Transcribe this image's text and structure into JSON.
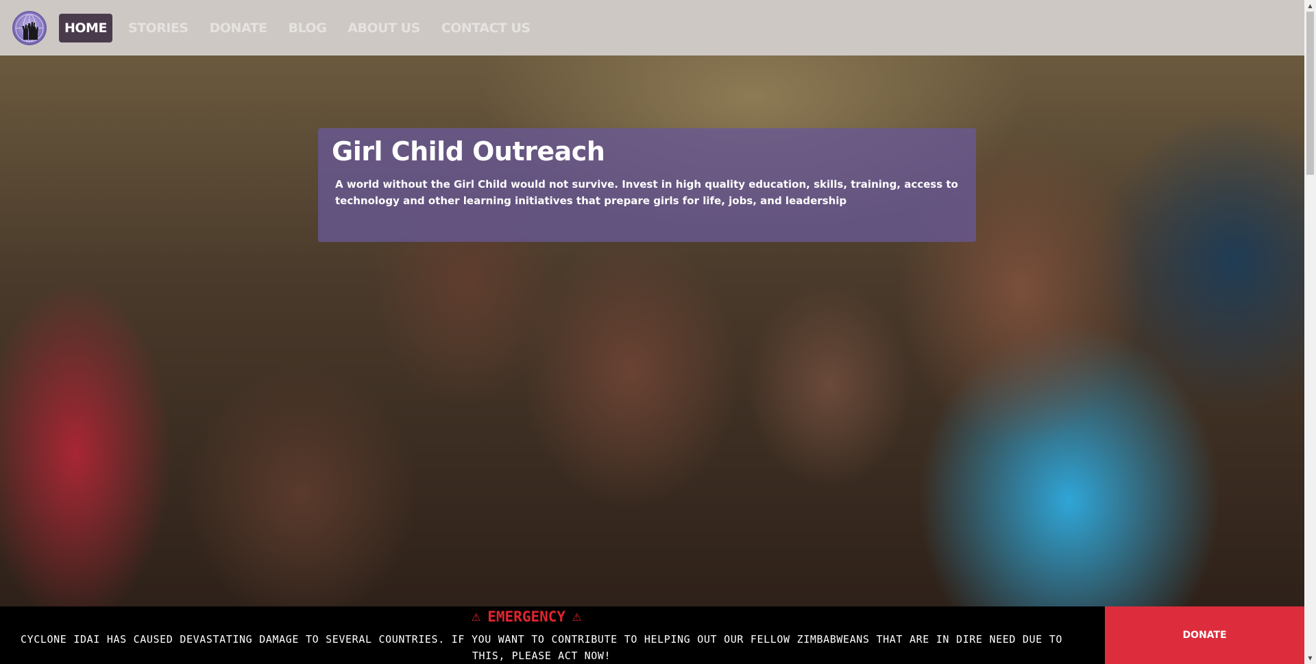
{
  "nav": {
    "logo_icon": "globe-hands-logo",
    "items": [
      {
        "label": "HOME",
        "active": true
      },
      {
        "label": "STORIES",
        "active": false
      },
      {
        "label": "DONATE",
        "active": false
      },
      {
        "label": "BLOG",
        "active": false
      },
      {
        "label": "ABOUT US",
        "active": false
      },
      {
        "label": "CONTACT US",
        "active": false
      }
    ]
  },
  "hero": {
    "title": "Girl Child Outreach",
    "text": "A world without the Girl Child would not survive. Invest in high quality education, skills, training, access to technology and other learning initiatives that prepare girls for life, jobs, and leadership"
  },
  "emergency": {
    "heading": "EMERGENCY",
    "warning_icon": "warning-triangle-icon",
    "message": "CYCLONE IDAI HAS CAUSED DEVASTATING DAMAGE TO SEVERAL COUNTRIES. IF YOU WANT TO CONTRIBUTE TO HELPING OUT OUR FELLOW ZIMBABWEANS THAT ARE IN DIRE NEED DUE TO THIS, PLEASE ACT NOW!",
    "donate_label": "DONATE"
  },
  "colors": {
    "nav_bg": "#cdc8c4",
    "nav_active_bg": "#4a3b4c",
    "hero_card_bg": "#6858a0",
    "emergency_red": "#e0242e",
    "donate_bg": "#dd2d3d"
  }
}
